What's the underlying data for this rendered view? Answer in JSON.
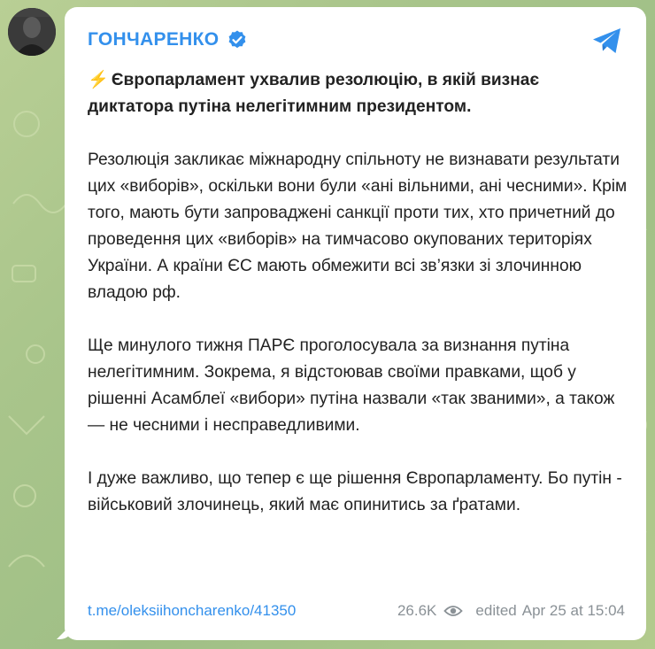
{
  "colors": {
    "accent": "#3390ec",
    "text": "#222222",
    "meta": "#8a9196",
    "background_green": "#a9c58b",
    "bolt": "#f5b800"
  },
  "post": {
    "channel_name": "ГОНЧАРЕНКО",
    "verified_icon": "verified-badge-icon",
    "share_icon": "telegram-plane-icon",
    "headline_emoji": "⚡",
    "headline": "Європарламент ухвалив резолюцію, в якій визнає диктатора путіна нелегітимним президентом.",
    "paragraphs": [
      "Резолюція закликає міжнародну спільноту не визнавати результати цих «виборів», оскільки вони були «ані вільними, ані чесними». Крім того, мають бути запроваджені санкції проти тих, хто причетний до проведення цих «виборів» на тимчасово окупованих територіях України. А країни ЄС мають обмежити всі зв’язки зі злочинною владою рф.",
      "Ще минулого тижня ПАРЄ проголосувала за визнання путіна нелегітимним. Зокрема, я відстоював своїми правками, щоб у рішенні Асамблеї «вибори» путіна назвали «так званими», а також — не чесними і несправедливими.",
      "І дуже важливо, що тепер є ще рішення Європарламенту. Бо путін - військовий злочинець, який має опинитись за ґратами."
    ],
    "link": "t.me/oleksiihoncharenko/41350",
    "views": "26.6K",
    "views_icon": "eye-icon",
    "edited_label": "edited",
    "timestamp": "Apr 25 at 15:04"
  }
}
